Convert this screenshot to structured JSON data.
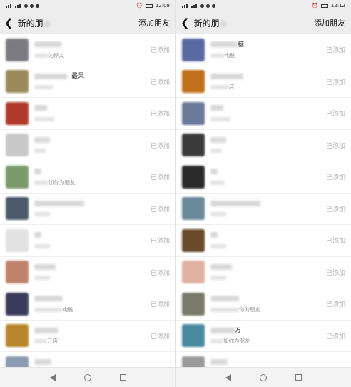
{
  "left": {
    "status": {
      "time": "12:08"
    },
    "nav": {
      "back_icon": "chevron-left-icon",
      "title": "新的朋",
      "action": "添加朋友"
    },
    "rows": [
      {
        "name": "",
        "sub": "为朋友",
        "status": "已添加",
        "color": "#7a7a80"
      },
      {
        "name": "- 最呆",
        "sub": "",
        "status": "已添加",
        "color": "#9a8a5a"
      },
      {
        "name": "",
        "sub": "",
        "status": "已添加",
        "color": "#b03a2a"
      },
      {
        "name": "",
        "sub": "",
        "status": "已添加",
        "color": "#c8c8c8"
      },
      {
        "name": "",
        "sub": "加你为朋友",
        "status": "已添加",
        "color": "#7a9a6a"
      },
      {
        "name": "",
        "sub": "",
        "status": "已添加",
        "color": "#4a5a6a"
      },
      {
        "name": "",
        "sub": "",
        "status": "已添加",
        "color": "#e2e2e2"
      },
      {
        "name": "",
        "sub": "",
        "status": "已添加",
        "color": "#c0826a"
      },
      {
        "name": "",
        "sub": "电脑",
        "status": "已添加",
        "color": "#3a3a5a"
      },
      {
        "name": "",
        "sub": "开店",
        "status": "已添加",
        "color": "#b8862a"
      },
      {
        "name": "",
        "sub": "",
        "status": "",
        "color": "#8a9ab0"
      }
    ]
  },
  "right": {
    "status": {
      "time": "12:12"
    },
    "nav": {
      "back_icon": "chevron-left-icon",
      "title": "新的朋",
      "action": "添加朋友"
    },
    "rows": [
      {
        "name": "脑",
        "sub": "电脑",
        "status": "已添加",
        "color": "#5a6aa0"
      },
      {
        "name": "",
        "sub": "店",
        "status": "已添加",
        "color": "#c0701a"
      },
      {
        "name": "",
        "sub": "",
        "status": "已添加",
        "color": "#6a7a9a"
      },
      {
        "name": "",
        "sub": "",
        "status": "已添加",
        "color": "#3a3a3a"
      },
      {
        "name": "",
        "sub": "",
        "status": "已添加",
        "color": "#2a2a2a"
      },
      {
        "name": "",
        "sub": "",
        "status": "已添加",
        "color": "#6a8a9a"
      },
      {
        "name": "",
        "sub": "",
        "status": "已添加",
        "color": "#6a4a2a"
      },
      {
        "name": "",
        "sub": "",
        "status": "已添加",
        "color": "#e0b0a0"
      },
      {
        "name": "",
        "sub": "你为朋友",
        "status": "已添加",
        "color": "#7a7a6a"
      },
      {
        "name": "方",
        "sub": "加你为朋友",
        "status": "已添加",
        "color": "#4a8aa0"
      },
      {
        "name": "",
        "sub": "",
        "status": "",
        "color": "#9a9a9a"
      }
    ]
  }
}
